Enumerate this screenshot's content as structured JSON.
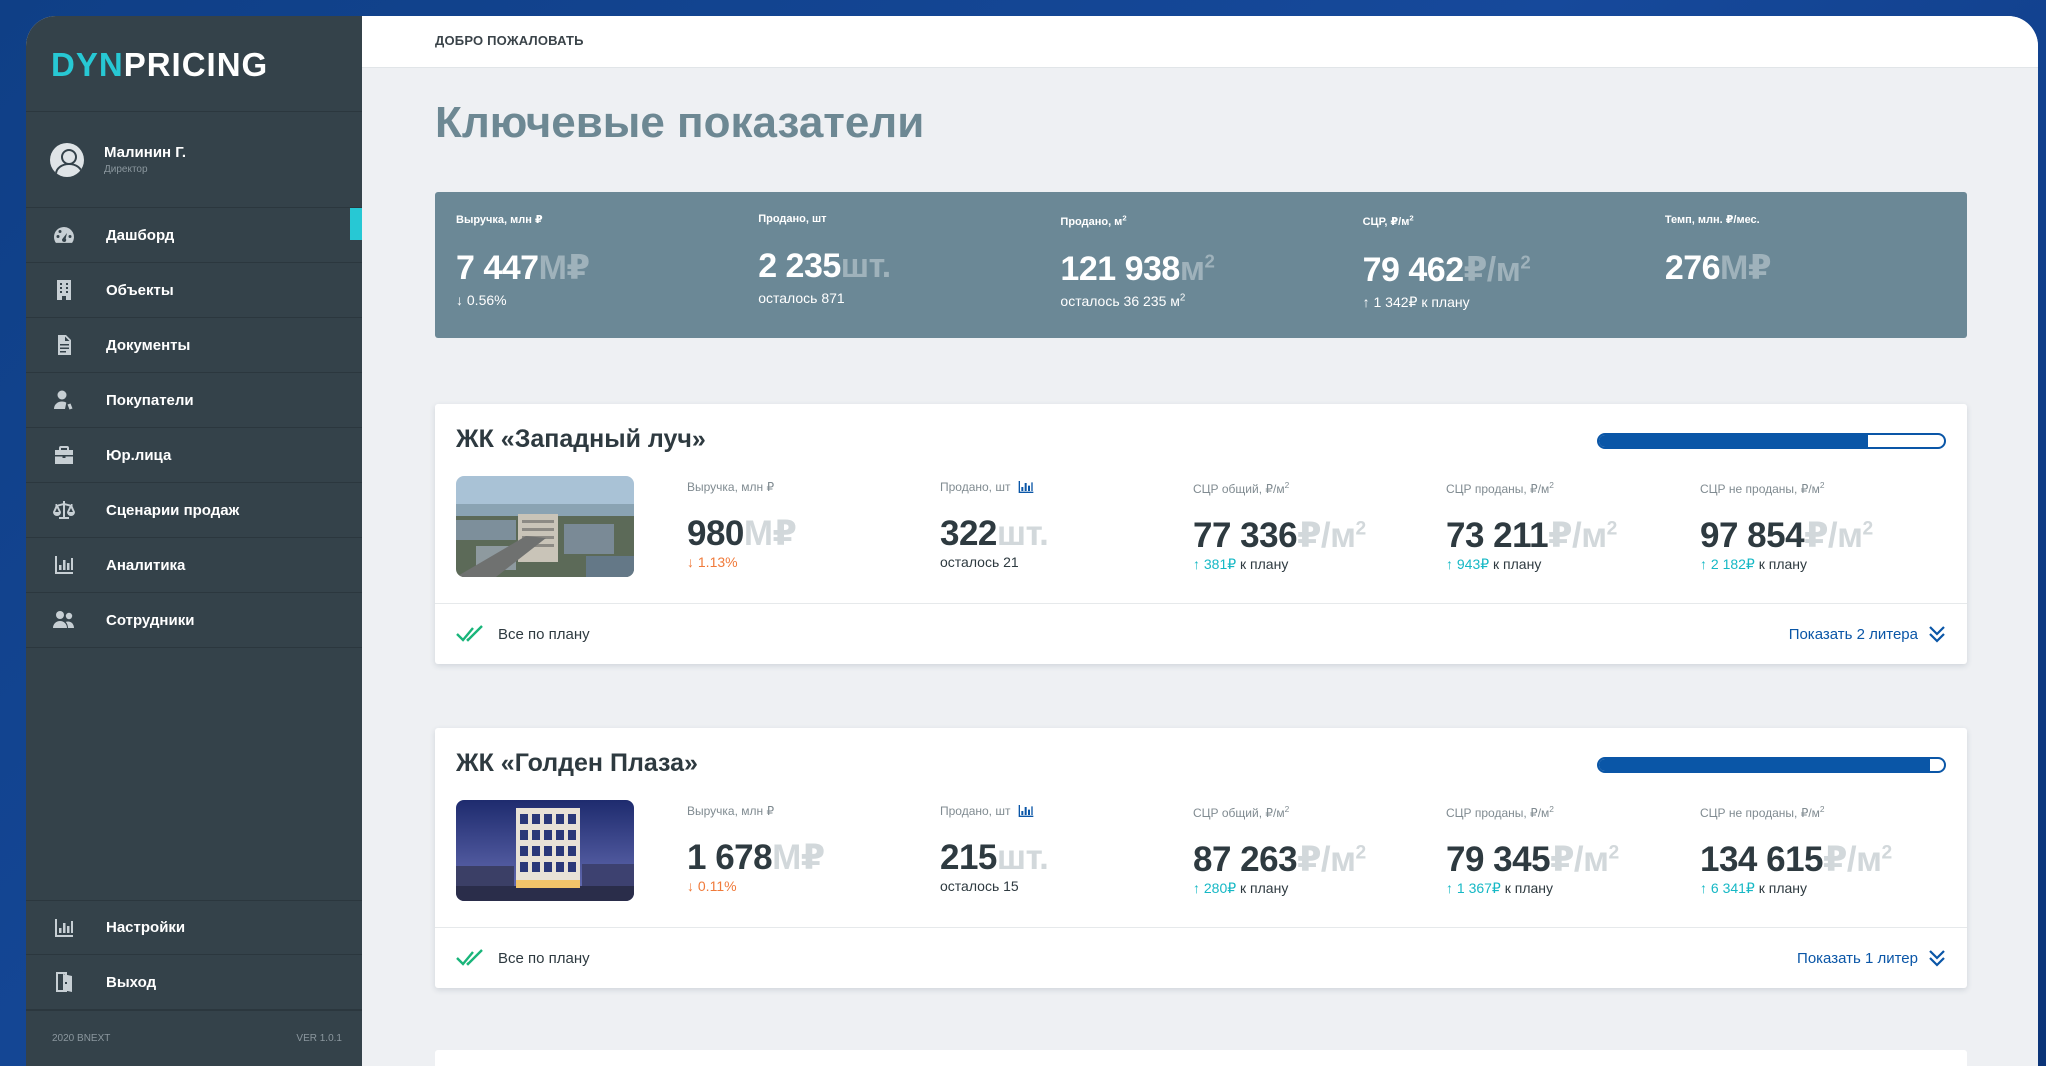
{
  "brand": {
    "logo_prefix": "DYN",
    "logo_rest": "PRICING"
  },
  "user": {
    "name": "Малинин Г.",
    "role": "Директор"
  },
  "sidebar": {
    "items": [
      {
        "label": "Дашборд",
        "icon": "speedometer-icon"
      },
      {
        "label": "Объекты",
        "icon": "building-icon"
      },
      {
        "label": "Документы",
        "icon": "document-icon"
      },
      {
        "label": "Покупатели",
        "icon": "user-icon"
      },
      {
        "label": "Юр.лица",
        "icon": "briefcase-icon"
      },
      {
        "label": "Сценарии продаж",
        "icon": "scales-icon"
      },
      {
        "label": "Аналитика",
        "icon": "bar-chart-icon"
      },
      {
        "label": "Сотрудники",
        "icon": "users-icon"
      }
    ],
    "bottom_items": [
      {
        "label": "Настройки",
        "icon": "bar-chart-icon"
      },
      {
        "label": "Выход",
        "icon": "exit-door-icon"
      }
    ],
    "footer": {
      "copyright": "2020 BNEXT",
      "version": "VER 1.0.1"
    }
  },
  "header": {
    "welcome": "ДОБРО ПОЖАЛОВАТЬ"
  },
  "page": {
    "title": "Ключевые показатели"
  },
  "kpis": [
    {
      "label": "Выручка, млн ₽",
      "value": "7 447",
      "unit": "М₽",
      "sub": "↓ 0.56%"
    },
    {
      "label": "Продано, шт",
      "value": "2 235",
      "unit": "шт.",
      "sub": "осталось 871"
    },
    {
      "label": "Продано, м",
      "label_sup": "2",
      "value": "121 938",
      "unit": "м",
      "unit_sup": "2",
      "sub": "осталось 36 235 м",
      "sub_sup": "2"
    },
    {
      "label": "СЦР, ₽/м",
      "label_sup": "2",
      "value": "79 462",
      "unit": "₽/м",
      "unit_sup": "2",
      "sub": "↑ 1 342₽ к плану"
    },
    {
      "label": "Темп, млн. ₽/мес.",
      "value": "276",
      "unit": "М₽",
      "sub": ""
    }
  ],
  "projects": [
    {
      "title": "ЖК «Западный луч»",
      "progress": 0.78,
      "status": "Все по плану",
      "show_link": "Показать 2 литера",
      "metrics": [
        {
          "label": "Выручка, млн ₽",
          "value": "980",
          "unit": "М₽",
          "trend": "↓ 1.13%",
          "trend_dir": "down",
          "rest": ""
        },
        {
          "label": "Продано, шт",
          "value": "322",
          "unit": "шт.",
          "trend": "",
          "rest": "осталось 21",
          "chart_icon": true
        },
        {
          "label": "СЦР общий, ₽/м",
          "label_sup": "2",
          "value": "77 336",
          "unit": "₽/м",
          "unit_sup": "2",
          "trend": "↑ 381₽",
          "trend_dir": "up",
          "rest": " к плану"
        },
        {
          "label": "СЦР проданы, ₽/м",
          "label_sup": "2",
          "value": "73 211",
          "unit": "₽/м",
          "unit_sup": "2",
          "trend": "↑ 943₽",
          "trend_dir": "up",
          "rest": " к плану"
        },
        {
          "label": "СЦР не проданы, ₽/м",
          "label_sup": "2",
          "value": "97 854",
          "unit": "₽/м",
          "unit_sup": "2",
          "trend": "↑ 2 182₽",
          "trend_dir": "up",
          "rest": " к плану"
        }
      ]
    },
    {
      "title": "ЖК «Голден Плаза»",
      "progress": 0.96,
      "status": "Все по плану",
      "show_link": "Показать 1 литер",
      "metrics": [
        {
          "label": "Выручка, млн ₽",
          "value": "1 678",
          "unit": "М₽",
          "trend": "↓ 0.11%",
          "trend_dir": "down",
          "rest": ""
        },
        {
          "label": "Продано, шт",
          "value": "215",
          "unit": "шт.",
          "trend": "",
          "rest": "осталось 15",
          "chart_icon": true
        },
        {
          "label": "СЦР общий, ₽/м",
          "label_sup": "2",
          "value": "87 263",
          "unit": "₽/м",
          "unit_sup": "2",
          "trend": "↑ 280₽",
          "trend_dir": "up",
          "rest": " к плану"
        },
        {
          "label": "СЦР проданы, ₽/м",
          "label_sup": "2",
          "value": "79 345",
          "unit": "₽/м",
          "unit_sup": "2",
          "trend": "↑ 1 367₽",
          "trend_dir": "up",
          "rest": " к плану"
        },
        {
          "label": "СЦР не проданы, ₽/м",
          "label_sup": "2",
          "value": "134 615",
          "unit": "₽/м",
          "unit_sup": "2",
          "trend": "↑ 6 341₽",
          "trend_dir": "up",
          "rest": " к плану"
        }
      ]
    }
  ],
  "colors": {
    "accent": "#27c8d4",
    "primary": "#0a56a7",
    "sidebar": "#34424a",
    "kpi_panel": "#6b8896",
    "trend_down": "#f07a3a",
    "trend_up": "#16b8c5"
  }
}
